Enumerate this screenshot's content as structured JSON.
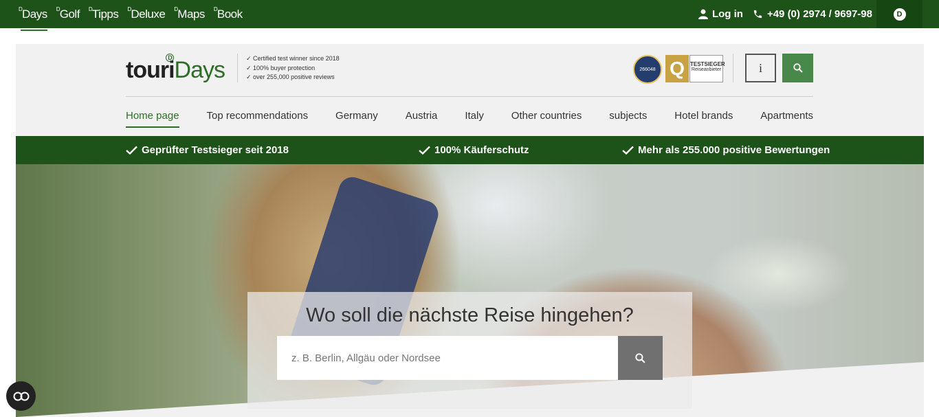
{
  "topbar": {
    "brand_tabs": [
      {
        "prefix": "D",
        "label": "Days"
      },
      {
        "prefix": "D",
        "label": "Golf"
      },
      {
        "prefix": "D",
        "label": "Tipps"
      },
      {
        "prefix": "D",
        "label": "Deluxe"
      },
      {
        "prefix": "D",
        "label": "Maps"
      },
      {
        "prefix": "D",
        "label": "Book"
      }
    ],
    "login_label": "Log in",
    "login_icon": "user-icon",
    "phone_label": "+49 (0) 2974 / 9697-98",
    "phone_icon": "phone-icon",
    "brand_badge": "D"
  },
  "header": {
    "logo": {
      "part1": "touri",
      "part2": "Days",
      "mark": "D"
    },
    "claims": [
      "Certified test winner since 2018",
      "100% buyer protection",
      "over 255,000 positive reviews"
    ],
    "seals": {
      "seal1_text": "266048",
      "seal2_text": "Q",
      "seal3_top": "TESTSIEGER",
      "seal3_bottom": "Reiseanbieter"
    },
    "info_label": "i",
    "search_icon": "search-icon"
  },
  "nav": {
    "items": [
      "Home page",
      "Top recommendations",
      "Germany",
      "Austria",
      "Italy",
      "Other countries",
      "subjects",
      "Hotel brands",
      "Apartments"
    ]
  },
  "trustbar": {
    "items": [
      "Geprüfter Testsieger seit 2018",
      "100% Käuferschutz",
      "Mehr als 255.000 positive Bewertungen"
    ],
    "icon": "check-icon"
  },
  "hero": {
    "title": "Wo soll die nächste Reise hingehen?",
    "search_placeholder": "z. B. Berlin, Allgäu oder Nordsee",
    "search_value": "",
    "submit_icon": "search-icon"
  },
  "accessibility": {
    "icon": "accessibility-icon"
  },
  "colors": {
    "brand_green": "#1d5218",
    "accent_green": "#48894a",
    "bg": "#f1f1f1"
  }
}
